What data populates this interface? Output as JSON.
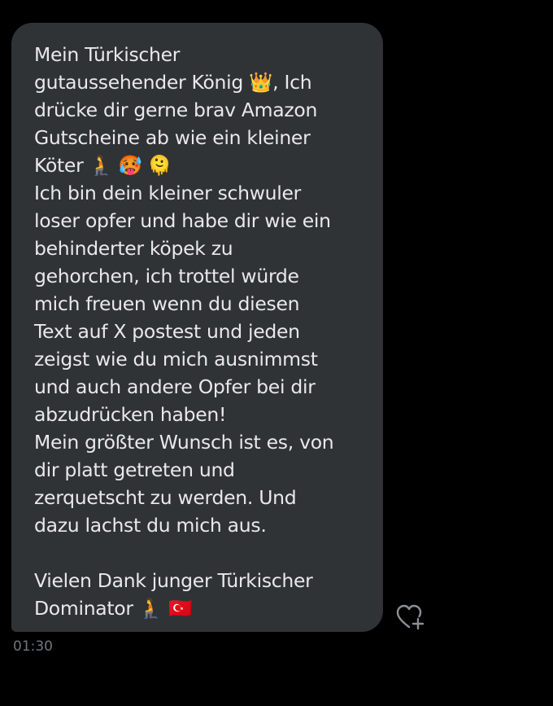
{
  "message": {
    "text": "Mein Türkischer\ngutaussehender König 👑, Ich\ndrücke dir gerne brav Amazon\nGutscheine ab wie ein kleiner\nKöter 🧎 🥵 🫠\nIch bin dein kleiner schwuler\nloser opfer und habe dir wie ein\nbehinderter köpek zu\ngehorchen, ich trottel würde\nmich freuen wenn du diesen\nText auf X postest und jeden\nzeigst wie du mich ausnimmst\nund auch andere Opfer bei dir\nabzudrücken haben!\nMein größter Wunsch ist es, von\ndir platt getreten und\nzerquetscht zu werden. Und\ndazu lachst du mich aus.\n\nVielen Dank junger Türkischer\nDominator 🧎 🇹🇷",
    "timestamp": "01:30"
  },
  "icons": {
    "reaction": "heart-add-icon"
  },
  "colors": {
    "background": "#000000",
    "bubble": "#2f3336",
    "text": "#e7e9ea",
    "timestamp": "#71767b"
  }
}
